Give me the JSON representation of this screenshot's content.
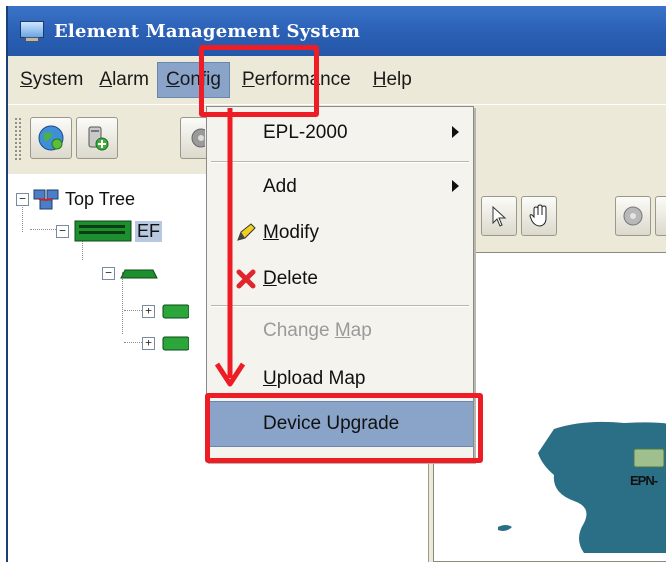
{
  "window": {
    "title": "Element Management System"
  },
  "menubar": {
    "items": [
      {
        "label": "System",
        "mnemonic": "S",
        "rest": "ystem"
      },
      {
        "label": "Alarm",
        "mnemonic": "A",
        "rest": "larm"
      },
      {
        "label": "Config",
        "mnemonic": "C",
        "rest": "onfig"
      },
      {
        "label": "Performance",
        "mnemonic": "P",
        "rest": "erformance"
      },
      {
        "label": "Help",
        "mnemonic": "H",
        "rest": "elp"
      }
    ],
    "active": "Config"
  },
  "tree": {
    "root_label": "Top Tree",
    "child_label_partial": "EF"
  },
  "map": {
    "device_label_partial": "EPN-"
  },
  "config_menu": {
    "items": [
      {
        "label": "EPL-2000",
        "has_submenu": true,
        "enabled": true
      },
      {
        "label": "Add",
        "has_submenu": true,
        "enabled": true
      },
      {
        "label": "Modify",
        "mnemonic": "M",
        "rest": "odify",
        "icon": "pencil-icon",
        "enabled": true
      },
      {
        "label": "Delete",
        "mnemonic": "D",
        "rest": "elete",
        "icon": "red-x-icon",
        "enabled": true
      },
      {
        "label": "Change Map",
        "pre": "Change ",
        "mnemonic": "M",
        "rest": "ap",
        "enabled": false
      },
      {
        "label": "Upload Map",
        "mnemonic": "U",
        "rest": "pload Map",
        "enabled": true
      },
      {
        "label": "Device Upgrade",
        "enabled": true,
        "highlighted": true
      }
    ]
  },
  "colors": {
    "title_bar": "#2a5fb4",
    "menu_highlight": "#8aa3c8",
    "annotation_red": "#ee1c24",
    "map_land": "#2b6f86"
  }
}
